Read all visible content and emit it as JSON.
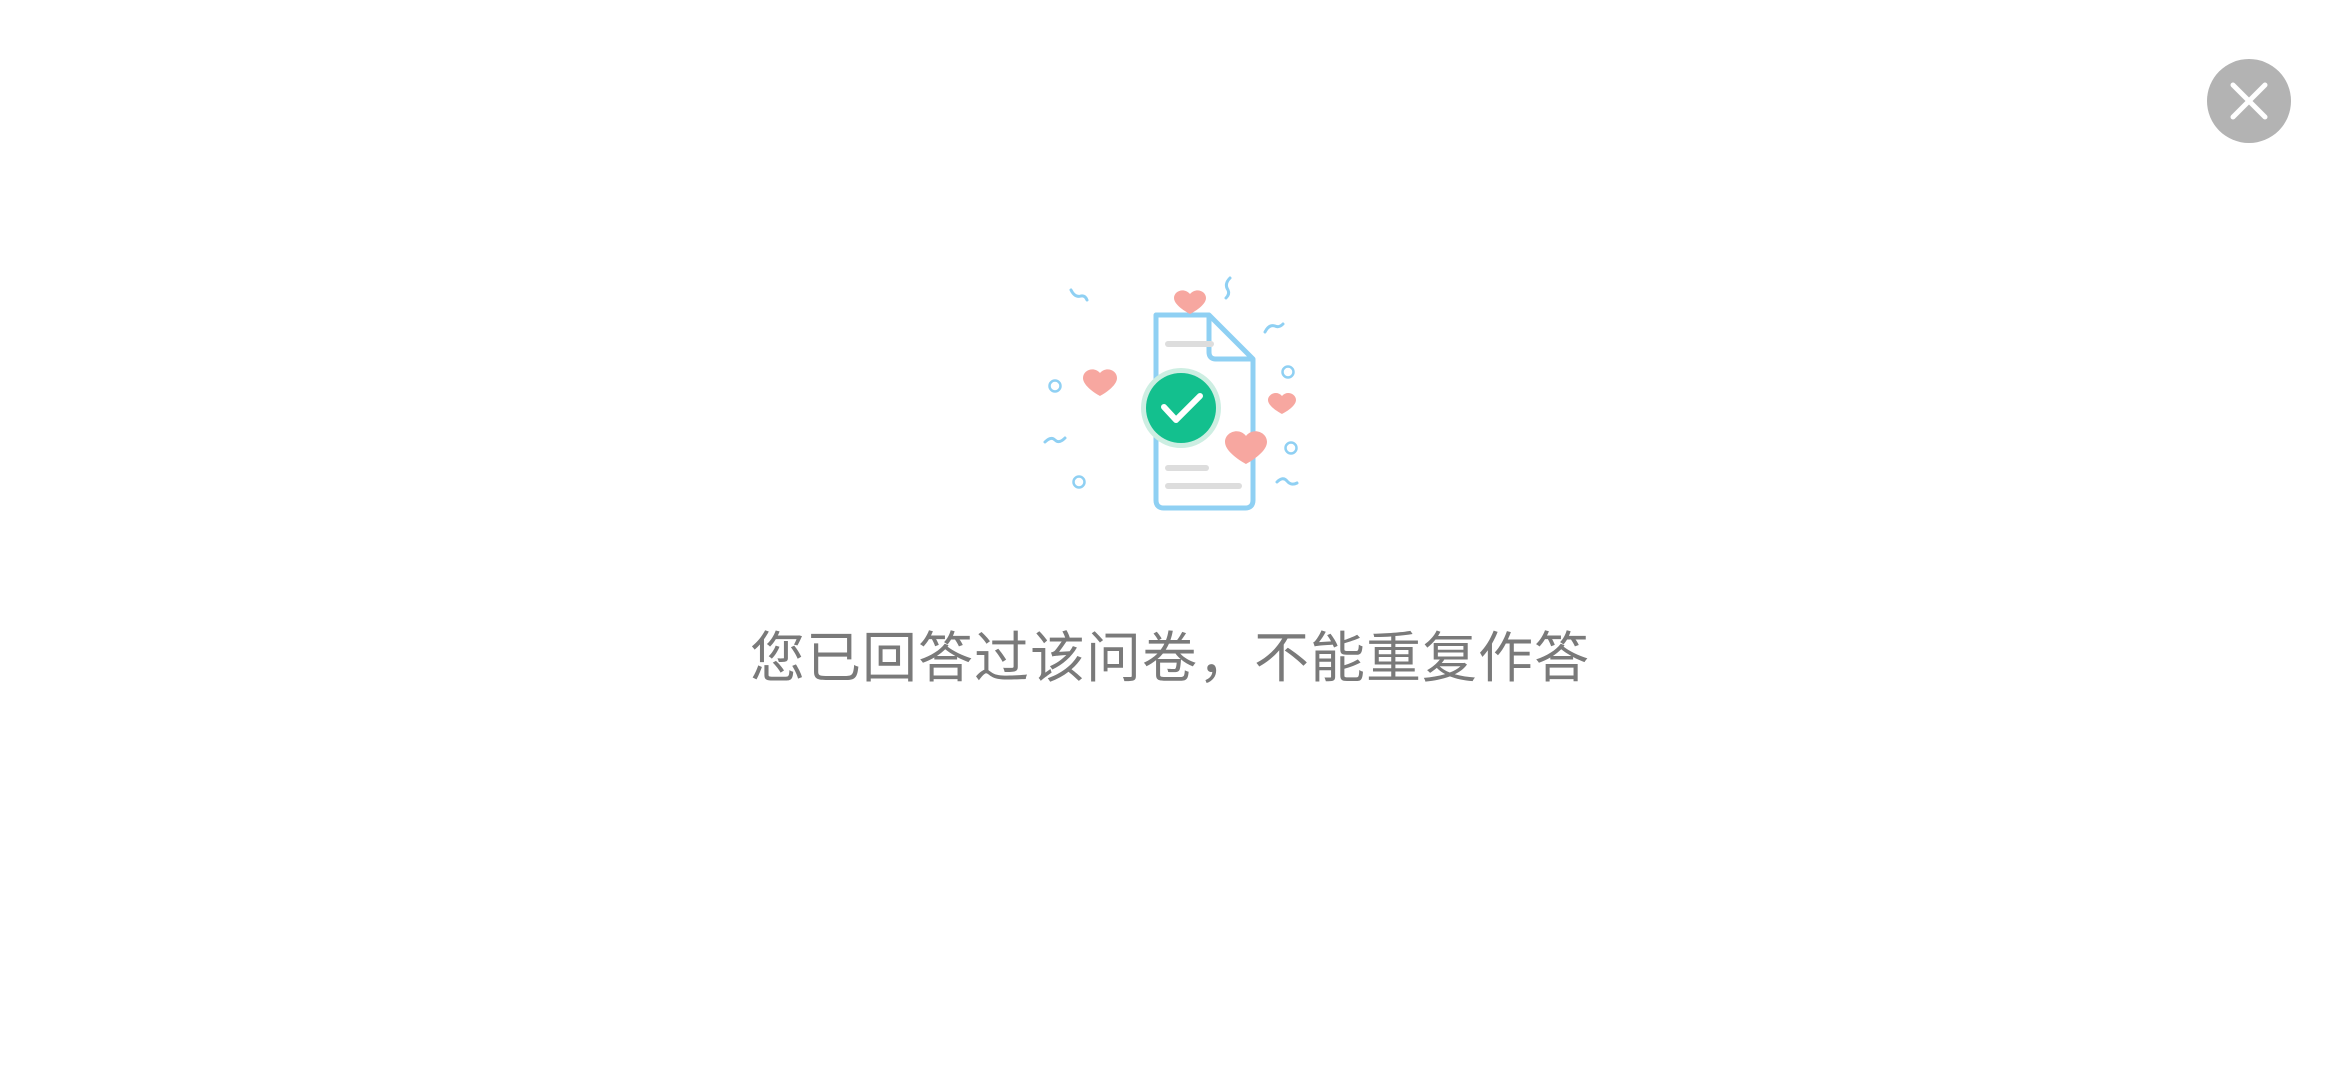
{
  "dialog": {
    "close_icon": "close-icon",
    "illustration_icon": "survey-completed-document-icon",
    "message": "您已回答过该问卷，不能重复作答"
  },
  "colors": {
    "close_button_bg": "#b3b3b3",
    "close_glyph": "#ffffff",
    "document_outline": "#8fd0f3",
    "check_circle": "#13c08e",
    "hearts": "#f7a7a0",
    "text_lines": "#dddddd",
    "message_text": "#7a7a7a"
  }
}
